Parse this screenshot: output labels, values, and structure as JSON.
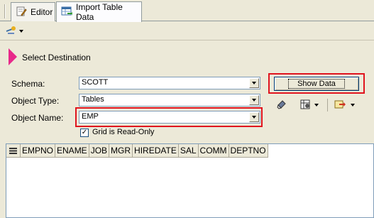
{
  "tabs": [
    {
      "label": "Editor",
      "icon": "editor-pencil-icon"
    },
    {
      "label": "Import Table Data",
      "icon": "import-table-icon"
    }
  ],
  "section": {
    "title": "Select Destination"
  },
  "form": {
    "schema_label": "Schema:",
    "schema_value": "SCOTT",
    "object_type_label": "Object Type:",
    "object_type_value": "Tables",
    "object_name_label": "Object Name:",
    "object_name_value": "EMP",
    "readonly_label": "Grid is Read-Only",
    "readonly_checked": "✓"
  },
  "buttons": {
    "show_data": "Show Data"
  },
  "grid": {
    "columns": [
      "EMPNO",
      "ENAME",
      "JOB",
      "MGR",
      "HIREDATE",
      "SAL",
      "COMM",
      "DEPTNO"
    ]
  },
  "colors": {
    "accent": "#e8288a",
    "highlight": "#e0141e"
  }
}
